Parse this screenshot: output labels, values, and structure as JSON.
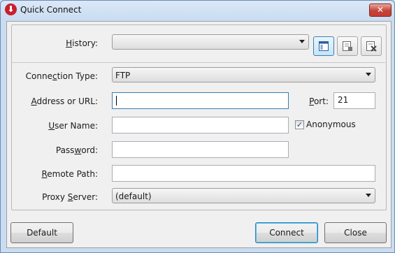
{
  "window": {
    "title": "Quick Connect"
  },
  "history": {
    "label_pre": "",
    "label_ul": "H",
    "label_post": "istory:",
    "value": ""
  },
  "connection_type": {
    "label_pre": "Conne",
    "label_ul": "c",
    "label_post": "tion Type:",
    "value": "FTP"
  },
  "address": {
    "label_pre": "",
    "label_ul": "A",
    "label_post": "ddress or URL:",
    "value": ""
  },
  "port": {
    "label_pre": "",
    "label_ul": "P",
    "label_post": "ort:",
    "value": "21"
  },
  "user_name": {
    "label_pre": "",
    "label_ul": "U",
    "label_post": "ser Name:",
    "value": ""
  },
  "anonymous": {
    "label": "Anonymous",
    "checked": true,
    "check_glyph": "✓"
  },
  "password": {
    "label_pre": "Pass",
    "label_ul": "w",
    "label_post": "ord:",
    "value": ""
  },
  "remote_path": {
    "label_pre": "",
    "label_ul": "R",
    "label_post": "emote Path:",
    "value": ""
  },
  "proxy_server": {
    "label_pre": "Proxy ",
    "label_ul": "S",
    "label_post": "erver:",
    "value": "(default)"
  },
  "buttons": {
    "default": "Default",
    "connect": "Connect",
    "close": "Close"
  },
  "icons": [
    "app-logo-icon",
    "close-icon",
    "history-window-icon",
    "history-edit-icon",
    "history-delete-icon",
    "dropdown-arrow-icon",
    "checkmark-icon"
  ]
}
